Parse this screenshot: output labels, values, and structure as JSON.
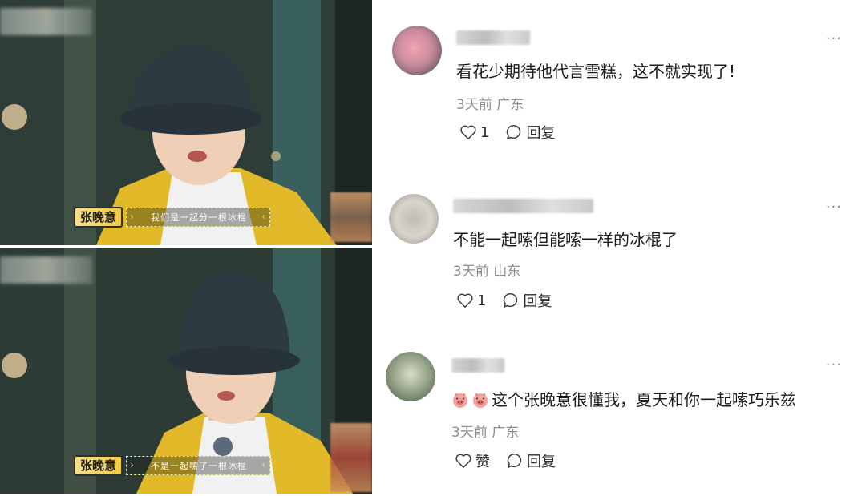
{
  "video_stills": [
    {
      "speaker_tag": "张晚意",
      "subtitle": "我们是一起分一根冰棍"
    },
    {
      "speaker_tag": "张晚意",
      "subtitle": "不是一起嗦了一根冰棍"
    }
  ],
  "comments": [
    {
      "text": "看花少期待他代言雪糕，这不就实现了!",
      "time": "3天前",
      "location": "广东",
      "likes": "1",
      "reply_label": "回复"
    },
    {
      "text": "不能一起嗦但能嗦一样的冰棍了",
      "time": "3天前",
      "location": "山东",
      "likes": "1",
      "reply_label": "回复"
    },
    {
      "text": "这个张晚意很懂我，夏天和你一起嗦巧乐兹",
      "time": "3天前",
      "location": "广东",
      "likes": "赞",
      "reply_label": "回复",
      "emoji_icons": [
        "pig-face-icon",
        "pig-face-icon"
      ]
    }
  ],
  "more_menu_label": "···",
  "colors": {
    "subtitle_border": "#e7f29a",
    "name_tag": "#f3c93e",
    "meta_text": "#8e8e8e"
  }
}
